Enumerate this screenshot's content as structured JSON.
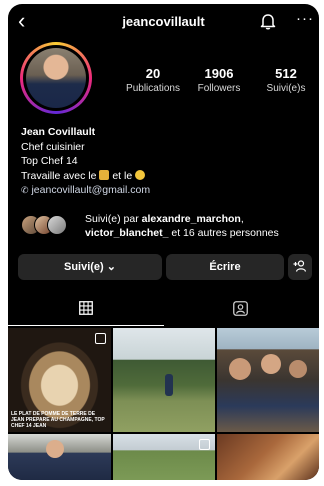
{
  "header": {
    "username": "jeancovillault",
    "back_icon": "chevron-left-icon",
    "notifications_icon": "bell-icon",
    "more_icon": "more-horizontal-icon",
    "more_glyph": "···"
  },
  "stats": [
    {
      "value": "20",
      "label": "Publications"
    },
    {
      "value": "1906",
      "label": "Followers"
    },
    {
      "value": "512",
      "label": "Suivi(e)s"
    }
  ],
  "bio": {
    "name": "Jean Covillault",
    "line1": "Chef cuisinier",
    "line2": "Top Chef 14",
    "line3_before": "Travaille avec le ",
    "line3_mid": " et le ",
    "email": "jeancovillault@gmail.com"
  },
  "followed_by": {
    "prefix": "Suivi(e) par ",
    "user1": "alexandre_marchon",
    "sep": ", ",
    "user2": "victor_blanchet_",
    "suffix": " et 16 autres personnes"
  },
  "actions": {
    "follow_label": "Suivi(e)",
    "follow_chevron": "⌄",
    "message_label": "Écrire",
    "suggest_icon": "add-person-icon"
  },
  "tabs": [
    "grid-icon",
    "tagged-icon"
  ],
  "posts": [
    {
      "caption": "LE PLAT DE POMME DE TERRE DE JEAN PREPARE AU CHAMPAGNE, TOP CHEF 14 JEAN",
      "multi": true
    },
    {
      "caption": "",
      "multi": false
    },
    {
      "caption": "",
      "multi": false
    },
    {
      "caption": "",
      "multi": false
    },
    {
      "caption": "",
      "multi": true
    },
    {
      "caption": "",
      "multi": false
    }
  ],
  "colors": {
    "background": "#000000",
    "button": "#262626",
    "secondary_text": "#d8d8d8"
  }
}
